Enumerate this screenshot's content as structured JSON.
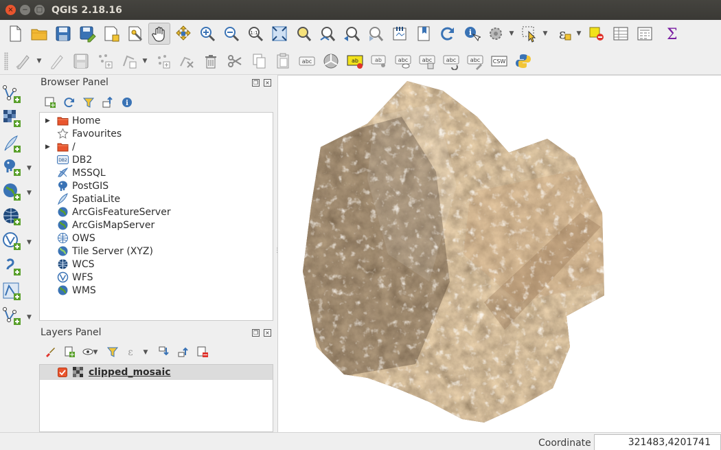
{
  "window": {
    "title": "QGIS 2.18.16",
    "close_glyph": "×",
    "min_glyph": "−",
    "max_glyph": "□"
  },
  "toolbar1": {
    "icons": [
      "new-project-icon",
      "open-project-icon",
      "save-project-icon",
      "save-as-icon",
      "new-print-composer-icon",
      "composer-manager-icon",
      "pan-icon",
      "pan-to-selection-icon",
      "zoom-in-icon",
      "zoom-out-icon",
      "zoom-actual-size-icon",
      "zoom-full-icon",
      "zoom-to-selection-icon",
      "zoom-to-layer-icon",
      "zoom-last-icon",
      "zoom-next-icon",
      "new-map-view-icon",
      "new-bookmark-icon",
      "show-bookmarks-icon",
      "refresh-icon",
      "identify-icon",
      "run-feature-action-icon",
      "select-features-icon",
      "select-by-expression-icon",
      "deselect-icon",
      "attribute-table-icon",
      "field-calculator-icon",
      "statistical-summary-icon"
    ]
  },
  "toolbar2": {
    "icons": [
      "current-edits-icon",
      "toggle-editing-icon",
      "save-layer-edits-icon",
      "add-feature-icon",
      "vertex-tool-icon",
      "add-ring-icon",
      "delete-ring-icon",
      "delete-selected-icon",
      "cut-features-icon",
      "copy-features-icon",
      "paste-features-icon",
      "label-toolbar-icon",
      "diagram-icon",
      "layer-labeling-icon",
      "pin-labels-icon",
      "show-hide-labels-icon",
      "move-label-icon",
      "rotate-label-icon",
      "change-label-icon",
      "csw-icon",
      "python-console-icon"
    ],
    "label_text": "abc",
    "csw_text": "CSW"
  },
  "left_toolbar": {
    "icons": [
      "add-vector-layer-icon",
      "add-raster-layer-icon",
      "add-spatialite-layer-icon",
      "add-postgis-layer-icon",
      "add-wms-layer-icon",
      "add-wcs-layer-icon",
      "add-wfs-layer-icon",
      "add-delimited-text-icon",
      "add-virtual-layer-icon",
      "new-shapefile-icon"
    ]
  },
  "browser_panel": {
    "title": "Browser Panel",
    "items": [
      {
        "label": "Home",
        "icon": "folder-icon",
        "expandable": true
      },
      {
        "label": "Favourites",
        "icon": "star-icon",
        "expandable": false
      },
      {
        "label": "/",
        "icon": "folder-icon",
        "expandable": true
      },
      {
        "label": "DB2",
        "icon": "db2-icon",
        "expandable": false
      },
      {
        "label": "MSSQL",
        "icon": "mssql-icon",
        "expandable": false
      },
      {
        "label": "PostGIS",
        "icon": "postgis-icon",
        "expandable": false
      },
      {
        "label": "SpatiaLite",
        "icon": "spatialite-icon",
        "expandable": false
      },
      {
        "label": "ArcGisFeatureServer",
        "icon": "arcgis-feature-icon",
        "expandable": false
      },
      {
        "label": "ArcGisMapServer",
        "icon": "arcgis-map-icon",
        "expandable": false
      },
      {
        "label": "OWS",
        "icon": "ows-icon",
        "expandable": false
      },
      {
        "label": "Tile Server (XYZ)",
        "icon": "xyz-icon",
        "expandable": false
      },
      {
        "label": "WCS",
        "icon": "wcs-icon",
        "expandable": false
      },
      {
        "label": "WFS",
        "icon": "wfs-icon",
        "expandable": false
      },
      {
        "label": "WMS",
        "icon": "wms-icon",
        "expandable": false
      }
    ],
    "db2_badge": "DB2"
  },
  "layers_panel": {
    "title": "Layers Panel",
    "layers": [
      {
        "name": "clipped_mosaic",
        "visible": true
      }
    ]
  },
  "status_bar": {
    "coordinate_label": "Coordinate",
    "coordinate_value": "321483,4201741"
  },
  "colors": {
    "titlebar": "#3a3935",
    "close_button": "#e9552e",
    "canvas_background": "#ffffff",
    "layer_row_selected": "#dcdcdc",
    "checkbox": "#e9552e"
  }
}
